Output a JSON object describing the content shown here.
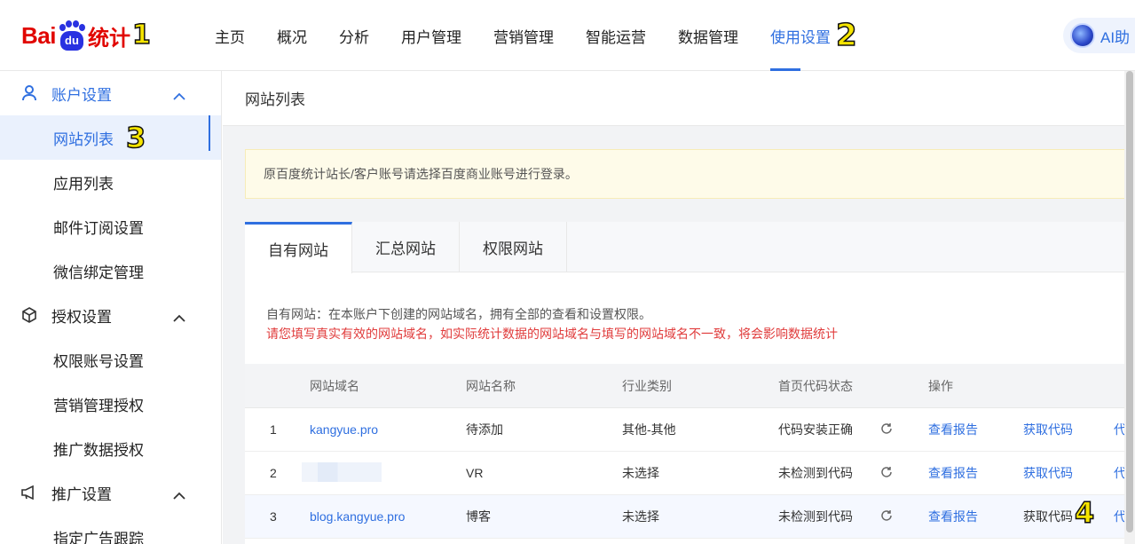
{
  "logo": {
    "bai": "Bai",
    "du": "du",
    "tongji": "统计",
    "marker": "1"
  },
  "nav": {
    "items": [
      "主页",
      "概况",
      "分析",
      "用户管理",
      "营销管理",
      "智能运营",
      "数据管理",
      "使用设置"
    ],
    "active_index": 7,
    "active_marker": "2",
    "ai_label": "AI助"
  },
  "sidebar": {
    "groups": [
      {
        "label": "账户设置",
        "icon": "user-icon",
        "items": [
          "网站列表",
          "应用列表",
          "邮件订阅设置",
          "微信绑定管理"
        ]
      },
      {
        "label": "授权设置",
        "icon": "cube-icon",
        "items": [
          "权限账号设置",
          "营销管理授权",
          "推广数据授权"
        ]
      },
      {
        "label": "推广设置",
        "icon": "megaphone-icon",
        "items": [
          "指定广告跟踪"
        ]
      }
    ],
    "active_item": "网站列表",
    "active_marker": "3"
  },
  "main": {
    "breadcrumb": "网站列表",
    "notice": "原百度统计站长/客户账号请选择百度商业账号进行登录。",
    "tabs": [
      "自有网站",
      "汇总网站",
      "权限网站"
    ],
    "active_tab": 0,
    "desc_line1": "自有网站：在本账户下创建的网站域名，拥有全部的查看和设置权限。",
    "desc_line2": "请您填写真实有效的网站域名，如实际统计数据的网站域名与填写的网站域名不一致，将会影响数据统计",
    "table": {
      "headers": [
        "网站域名",
        "网站名称",
        "行业类别",
        "首页代码状态",
        "操作"
      ],
      "rows": [
        {
          "idx": "1",
          "domain": "kangyue.pro",
          "name": "待添加",
          "industry": "其他-其他",
          "status": "代码安装正确",
          "op1": "查看报告",
          "op2": "获取代码",
          "op3": "代"
        },
        {
          "idx": "2",
          "domain": "",
          "name": "VR",
          "industry": "未选择",
          "status": "未检测到代码",
          "op1": "查看报告",
          "op2": "获取代码",
          "op3": "代"
        },
        {
          "idx": "3",
          "domain": "blog.kangyue.pro",
          "name": "博客",
          "industry": "未选择",
          "status": "未检测到代码",
          "op1": "查看报告",
          "op2": "获取代码",
          "op3": "代"
        }
      ],
      "row3_marker": "4"
    }
  },
  "colors": {
    "accent": "#2f6fe0",
    "logo_red": "#e10601",
    "logo_blue": "#2932e1",
    "warn_red": "#e03b3b",
    "marker_yellow": "#f5e400"
  }
}
